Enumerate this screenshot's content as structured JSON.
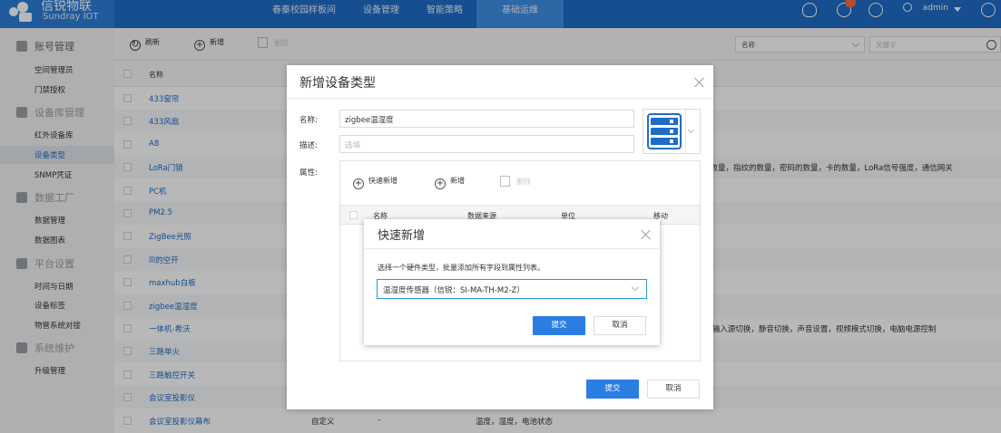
{
  "app": {
    "logo_title": "信锐物联",
    "logo_subtitle": "Sundray IOT"
  },
  "topnav": [
    {
      "label": "春秦校园样板间"
    },
    {
      "label": "设备管理"
    },
    {
      "label": "智能策略"
    },
    {
      "label": "基础运维",
      "active": true
    }
  ],
  "user": {
    "name": "admin"
  },
  "colors": {
    "primary": "#1f6cc7",
    "active_nav": "#3d8fe6",
    "badge": "#ff6a3d"
  },
  "sidebar": {
    "groups": [
      {
        "label": "账号管理",
        "icon": "user-group-icon",
        "items": [
          "空间管理员",
          "门禁授权"
        ]
      },
      {
        "label": "设备库管理",
        "icon": "device-library-icon",
        "items": [
          "红外设备库",
          "设备类型",
          "SNMP凭证"
        ]
      },
      {
        "label": "数据工厂",
        "icon": "data-factory-icon",
        "items": [
          "数据管理",
          "数据图表"
        ]
      },
      {
        "label": "平台设置",
        "icon": "settings-icon",
        "items": [
          "时间与日期",
          "设备标签",
          "物管系统对接"
        ]
      },
      {
        "label": "系统维护",
        "icon": "system-icon",
        "items": [
          "升级管理"
        ]
      }
    ],
    "active_item": "设备类型"
  },
  "toolbar": {
    "refresh": "刷新",
    "add": "新增",
    "delete": "删除",
    "filter_select": "名称",
    "keyword_placeholder": "关键字"
  },
  "table": {
    "header_name": "名称",
    "rows": [
      {
        "name": "433窗帘"
      },
      {
        "name": "433风扇"
      },
      {
        "name": "A8"
      },
      {
        "name": "LoRa门锁",
        "attrs": "户数量，指纹的数量，密码的数量，卡的数量，LoRa信号强度，通信网关"
      },
      {
        "name": "PC机"
      },
      {
        "name": "PM2.5"
      },
      {
        "name": "ZigBee光照"
      },
      {
        "name": "lll的空开"
      },
      {
        "name": "maxhub白板"
      },
      {
        "name": "zigbee温湿度"
      },
      {
        "name": "一体机-希沃",
        "attrs": "l，输入源切换，静音切换，声音设置，视频模式切换，电脑电源控制"
      },
      {
        "name": "三路单火"
      },
      {
        "name": "三路触控开关"
      },
      {
        "name": "会议室投影仪"
      },
      {
        "name": "会议室投影仪幕布",
        "source": "自定义",
        "dash": "-",
        "attrs": "温度，湿度，电池状态"
      }
    ]
  },
  "dialog_add_type": {
    "title": "新增设备类型",
    "name_label": "名称:",
    "name_value": "zigbee温湿度",
    "desc_label": "描述:",
    "desc_placeholder": "选填",
    "attr_label": "属性:",
    "quick_add": "快速新增",
    "add": "新增",
    "delete": "删除",
    "columns": [
      "名称",
      "数据来源",
      "单位",
      "移动"
    ],
    "submit": "提交",
    "cancel": "取消"
  },
  "dialog_quick_add": {
    "title": "快速新增",
    "hint": "选择一个硬件类型，批量添加所有字段到属性列表。",
    "selected": "温湿度传感器（信锐：SI-MA-TH-M2-Z）",
    "submit": "提交",
    "cancel": "取消"
  }
}
